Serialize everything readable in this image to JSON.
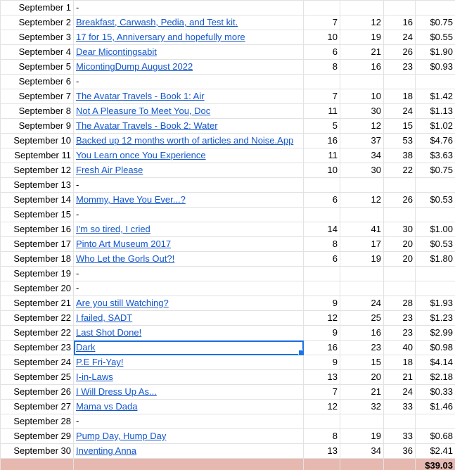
{
  "rows": [
    {
      "date": "September 1",
      "title": "",
      "a": "",
      "b": "",
      "c": "",
      "amount": ""
    },
    {
      "date": "September 2",
      "title": "Breakfast, Carwash, Pedia, and Test kit.",
      "a": "7",
      "b": "12",
      "c": "16",
      "amount": "$0.75"
    },
    {
      "date": "September 3",
      "title": "17 for 15, Anniversary and hopefully more",
      "a": "10",
      "b": "19",
      "c": "24",
      "amount": "$0.55"
    },
    {
      "date": "September 4",
      "title": "Dear Micontingsabit",
      "a": "6",
      "b": "21",
      "c": "26",
      "amount": "$1.90"
    },
    {
      "date": "September 5",
      "title": "MicontingDump August 2022",
      "a": "8",
      "b": "16",
      "c": "23",
      "amount": "$0.93"
    },
    {
      "date": "September 6",
      "title": "",
      "a": "",
      "b": "",
      "c": "",
      "amount": ""
    },
    {
      "date": "September 7",
      "title": "The Avatar Travels - Book 1: Air",
      "a": "7",
      "b": "10",
      "c": "18",
      "amount": "$1.42"
    },
    {
      "date": "September 8",
      "title": "Not A Pleasure To Meet You, Doc",
      "a": "11",
      "b": "30",
      "c": "24",
      "amount": "$1.13"
    },
    {
      "date": "September 9",
      "title": "The Avatar Travels - Book 2: Water",
      "a": "5",
      "b": "12",
      "c": "15",
      "amount": "$1.02"
    },
    {
      "date": "September 10",
      "title": "Backed up 12 months worth of articles and Noise.App",
      "a": "16",
      "b": "37",
      "c": "53",
      "amount": "$4.76"
    },
    {
      "date": "September 11",
      "title": "You Learn once You Experience",
      "a": "11",
      "b": "34",
      "c": "38",
      "amount": "$3.63"
    },
    {
      "date": "September 12",
      "title": "Fresh Air Please",
      "a": "10",
      "b": "30",
      "c": "22",
      "amount": "$0.75"
    },
    {
      "date": "September 13",
      "title": "",
      "a": "",
      "b": "",
      "c": "",
      "amount": ""
    },
    {
      "date": "September 14",
      "title": "Mommy, Have You Ever...?",
      "a": "6",
      "b": "12",
      "c": "26",
      "amount": "$0.53"
    },
    {
      "date": "September 15",
      "title": "",
      "a": "",
      "b": "",
      "c": "",
      "amount": ""
    },
    {
      "date": "September 16",
      "title": "I'm so tired, I cried",
      "a": "14",
      "b": "41",
      "c": "30",
      "amount": "$1.00"
    },
    {
      "date": "September 17",
      "title": "Pinto Art Museum 2017",
      "a": "8",
      "b": "17",
      "c": "20",
      "amount": "$0.53"
    },
    {
      "date": "September 18",
      "title": "Who Let the Gorls Out?!",
      "a": "6",
      "b": "19",
      "c": "20",
      "amount": "$1.80"
    },
    {
      "date": "September 19",
      "title": "",
      "a": "",
      "b": "",
      "c": "",
      "amount": ""
    },
    {
      "date": "September 20",
      "title": "",
      "a": "",
      "b": "",
      "c": "",
      "amount": ""
    },
    {
      "date": "September 21",
      "title": "Are you still Watching?",
      "a": "9",
      "b": "24",
      "c": "28",
      "amount": "$1.93"
    },
    {
      "date": "September 22",
      "title": "I failed, SADT",
      "a": "12",
      "b": "25",
      "c": "23",
      "amount": "$1.23"
    },
    {
      "date": "September 22",
      "title": "Last Shot Done!",
      "a": "9",
      "b": "16",
      "c": "23",
      "amount": "$2.99"
    },
    {
      "date": "September 23",
      "title": "Dark",
      "a": "16",
      "b": "23",
      "c": "40",
      "amount": "$0.98",
      "selected": true
    },
    {
      "date": "September 24",
      "title": "P.E Fri-Yay!",
      "a": "9",
      "b": "15",
      "c": "18",
      "amount": "$4.14"
    },
    {
      "date": "September 25",
      "title": "I-in-Laws",
      "a": "13",
      "b": "20",
      "c": "21",
      "amount": "$2.18"
    },
    {
      "date": "September 26",
      "title": "I Will Dress Up As...",
      "a": "7",
      "b": "21",
      "c": "24",
      "amount": "$0.33"
    },
    {
      "date": "September 27",
      "title": "Mama vs Dada",
      "a": "12",
      "b": "32",
      "c": "33",
      "amount": "$1.46"
    },
    {
      "date": "September 28",
      "title": "",
      "a": "",
      "b": "",
      "c": "",
      "amount": ""
    },
    {
      "date": "September 29",
      "title": "Pump Day, Hump Day",
      "a": "8",
      "b": "19",
      "c": "33",
      "amount": "$0.68"
    },
    {
      "date": "September 30",
      "title": "Inventing Anna",
      "a": "13",
      "b": "34",
      "c": "36",
      "amount": "$2.41"
    }
  ],
  "empty_marker": "-",
  "total": {
    "amount": "$39.03"
  },
  "colors": {
    "link": "#1155cc",
    "selection": "#1a73e8",
    "total_row": "#e6b8af",
    "grid": "#e2e2e2"
  }
}
